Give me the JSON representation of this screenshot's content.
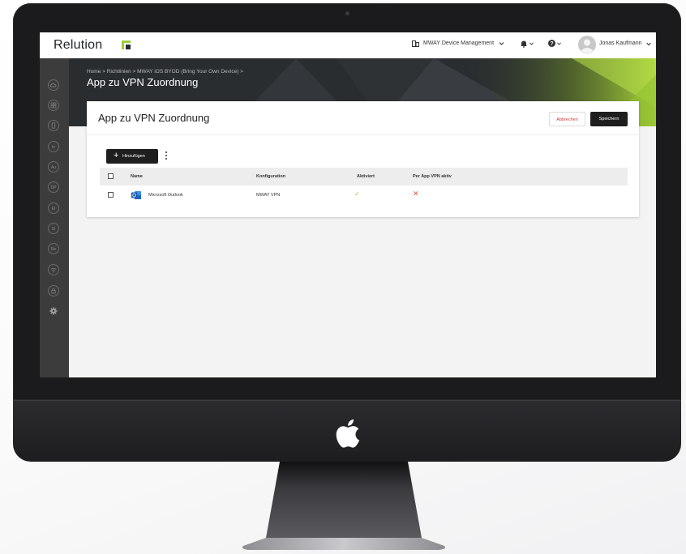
{
  "header": {
    "logo": "Relution",
    "org_menu": "MWAY Device Management",
    "user_name": "Jonas Kaufmann"
  },
  "sidebar": {
    "items": [
      {
        "icon": "cloud-icon",
        "label": ""
      },
      {
        "icon": "grid-icon",
        "label": ""
      },
      {
        "icon": "device-icon",
        "label": ""
      },
      {
        "icon": "",
        "label": "In"
      },
      {
        "icon": "",
        "label": "Au"
      },
      {
        "icon": "",
        "label": "DP"
      },
      {
        "icon": "",
        "label": "EI"
      },
      {
        "icon": "",
        "label": "Si"
      },
      {
        "icon": "",
        "label": "Re"
      },
      {
        "icon": "wifi-icon",
        "label": ""
      },
      {
        "icon": "lock-icon",
        "label": ""
      },
      {
        "icon": "gear-icon",
        "label": ""
      }
    ]
  },
  "page": {
    "breadcrumb": "Home > Richtlinien > MWAY iOS BYOD (Bring Your Own Device) >",
    "title": "App zu VPN Zuordnung"
  },
  "card": {
    "title": "App zu VPN Zuordnung",
    "cancel_label": "Abbrechen",
    "save_label": "Speichern",
    "add_label": "Hinzufügen"
  },
  "table": {
    "columns": [
      "Name",
      "Konfiguration",
      "Aktiviert",
      "Per App VPN aktiv"
    ],
    "rows": [
      {
        "name": "Microsoft Outlook",
        "configuration": "MWAY VPN",
        "activated": true,
        "per_app_vpn": false
      }
    ]
  },
  "colors": {
    "accent_green": "#9bcf3a",
    "danger_red": "#d23c3c",
    "sidebar_bg": "#3c3c3c",
    "button_dark": "#1e1e1e"
  }
}
